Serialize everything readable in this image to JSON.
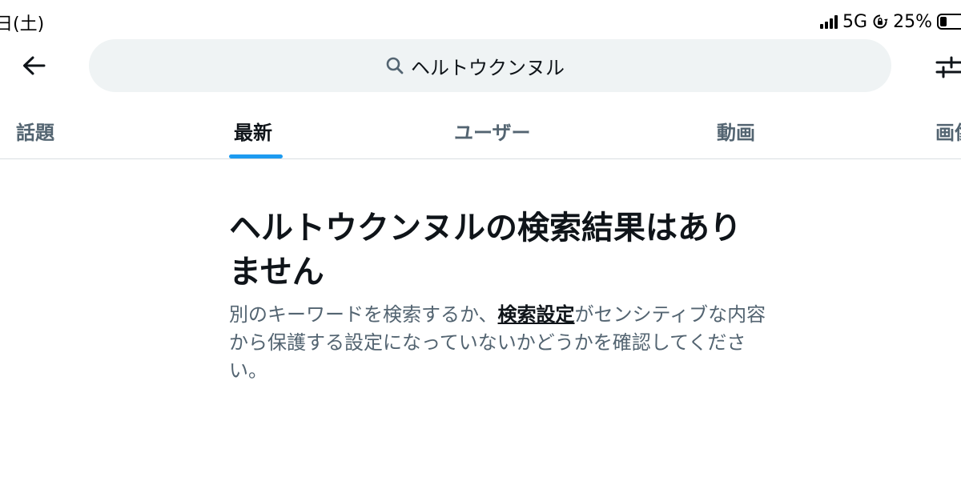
{
  "status_bar": {
    "time": "日(土)",
    "network": "5G",
    "battery_percent": "25%",
    "battery_level": 0.25
  },
  "search": {
    "query": "ヘルトウクンヌル",
    "icons": {
      "back": "arrow-left-icon",
      "search": "search-icon",
      "filter": "sliders-icon"
    }
  },
  "tabs": [
    {
      "label": "話題",
      "active": false
    },
    {
      "label": "最新",
      "active": true
    },
    {
      "label": "ユーザー",
      "active": false
    },
    {
      "label": "動画",
      "active": false
    },
    {
      "label": "画像",
      "active": false
    }
  ],
  "empty_state": {
    "title": "ヘルトウクンヌルの検索結果はありません",
    "description_before": "別のキーワードを検索するか、",
    "link_label": "検索設定",
    "description_after": "がセンシティブな内容から保護する設定になっていないかどうかを確認してください。"
  },
  "colors": {
    "accent": "#1d9bf0",
    "text_primary": "#0f1419",
    "text_secondary": "#536471",
    "search_bg": "#eff3f4"
  }
}
